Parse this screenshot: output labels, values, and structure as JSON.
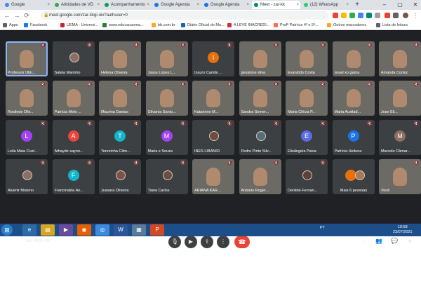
{
  "browser": {
    "tabs": [
      {
        "title": "Google",
        "color": "#4285f4",
        "active": false
      },
      {
        "title": "Atividades de VD",
        "color": "#34a853",
        "active": false
      },
      {
        "title": "Acompanhamento",
        "color": "#0f9d58",
        "active": false
      },
      {
        "title": "Google Agenda",
        "color": "#1a73e8",
        "active": false
      },
      {
        "title": "Google Agenda",
        "color": "#1a73e8",
        "active": false
      },
      {
        "title": "Meet - zar-kk",
        "color": "#00897b",
        "active": true
      },
      {
        "title": "(12) WhatsApp",
        "color": "#25d366",
        "active": false
      }
    ],
    "new_tab": "+",
    "url": "meet.google.com/zar-kkgi-oix?authuser=0",
    "bookmarks": [
      {
        "label": "Apps",
        "color": "#5f6368"
      },
      {
        "label": "Facebook",
        "color": "#1877f2"
      },
      {
        "label": "UEMA - Universi...",
        "color": "#c62828"
      },
      {
        "label": "www.educacaoma...",
        "color": "#2e7d32"
      },
      {
        "label": "bb.com.br",
        "color": "#f9a825"
      },
      {
        "label": "Diário Oficial do Mu...",
        "color": "#1565c0"
      },
      {
        "label": "A LEVE INACREDI...",
        "color": "#d32f2f"
      },
      {
        "label": "Profª Patrícia 4º e 5º...",
        "color": "#ff7043"
      },
      {
        "label": "Outros marcadores",
        "color": "#f9a825"
      },
      {
        "label": "Lista de leitura",
        "color": "#5f6368"
      }
    ]
  },
  "participants": [
    {
      "name": "Professor Ubir...",
      "type": "video",
      "active": true
    },
    {
      "name": "Saleta Marinho",
      "type": "photo",
      "color": "#8d6e63"
    },
    {
      "name": "Helena Oliveira",
      "type": "video"
    },
    {
      "name": "Jasse Lopes L...",
      "type": "video"
    },
    {
      "name": "Izauro Camilo ...",
      "type": "avatar",
      "initial": "I",
      "color": "#e8710a"
    },
    {
      "name": "gessione silva",
      "type": "video"
    },
    {
      "name": "Evandido Costa",
      "type": "video"
    },
    {
      "name": "israel xo gama",
      "type": "video"
    },
    {
      "name": "Amanda Cortez",
      "type": "video"
    },
    {
      "name": "Rosilede Oliv...",
      "type": "video"
    },
    {
      "name": "Patrícia Melo ...",
      "type": "video"
    },
    {
      "name": "Maurina Dantas",
      "type": "video"
    },
    {
      "name": "Gilvania Santo...",
      "type": "video"
    },
    {
      "name": "Katarinne M...",
      "type": "video"
    },
    {
      "name": "Sandra Semer...",
      "type": "video"
    },
    {
      "name": "Maria Clécia P...",
      "type": "video"
    },
    {
      "name": "Maria Auxilad...",
      "type": "video"
    },
    {
      "name": "Jose Eli...",
      "type": "video"
    },
    {
      "name": "Leila Maia Cust...",
      "type": "avatar",
      "initial": "L",
      "color": "#a142f4"
    },
    {
      "name": "Athayde sayon...",
      "type": "avatar",
      "initial": "A",
      "color": "#e8453c"
    },
    {
      "name": "Terezinha Câm...",
      "type": "avatar",
      "initial": "T",
      "color": "#12b5cb"
    },
    {
      "name": "Maria e Souza",
      "type": "avatar",
      "initial": "M",
      "color": "#a142f4"
    },
    {
      "name": "INÊS LIBANIO",
      "type": "photo",
      "color": "#6d4c41"
    },
    {
      "name": "Pedro Pinto Silv...",
      "type": "photo",
      "color": "#546e7a"
    },
    {
      "name": "Elisângela Paiva",
      "type": "avatar",
      "initial": "E",
      "color": "#5b6ee1"
    },
    {
      "name": "Patrícia Heliena",
      "type": "avatar",
      "initial": "P",
      "color": "#1a73e8"
    },
    {
      "name": "Marcelo Câmar...",
      "type": "avatar",
      "initial": "M",
      "color": "#8d6e63"
    },
    {
      "name": "Alvenir Moreno",
      "type": "photo",
      "color": "#8d6e63"
    },
    {
      "name": "Francinalda Ân...",
      "type": "avatar",
      "initial": "F",
      "color": "#12b5cb"
    },
    {
      "name": "Jussara Oliveira",
      "type": "photo",
      "color": "#795548"
    },
    {
      "name": "Tiana Carlos",
      "type": "photo",
      "color": "#6d4c41"
    },
    {
      "name": "ARIANA KAR...",
      "type": "video"
    },
    {
      "name": "Antonio Roger...",
      "type": "video"
    },
    {
      "name": "Denilde Fernan...",
      "type": "photo",
      "color": "#5d4037"
    },
    {
      "name": "Mais 6 pessoas",
      "type": "more",
      "color": "#e8710a"
    },
    {
      "name": "Você",
      "type": "video"
    }
  ],
  "controls": {
    "time": "10:58",
    "meeting_code": "zar-kkgi-oix",
    "people_count": "43",
    "chat_count": "3"
  },
  "taskbar": {
    "tray_text": "PT",
    "time": "10:58",
    "date": "23/07/2021"
  }
}
